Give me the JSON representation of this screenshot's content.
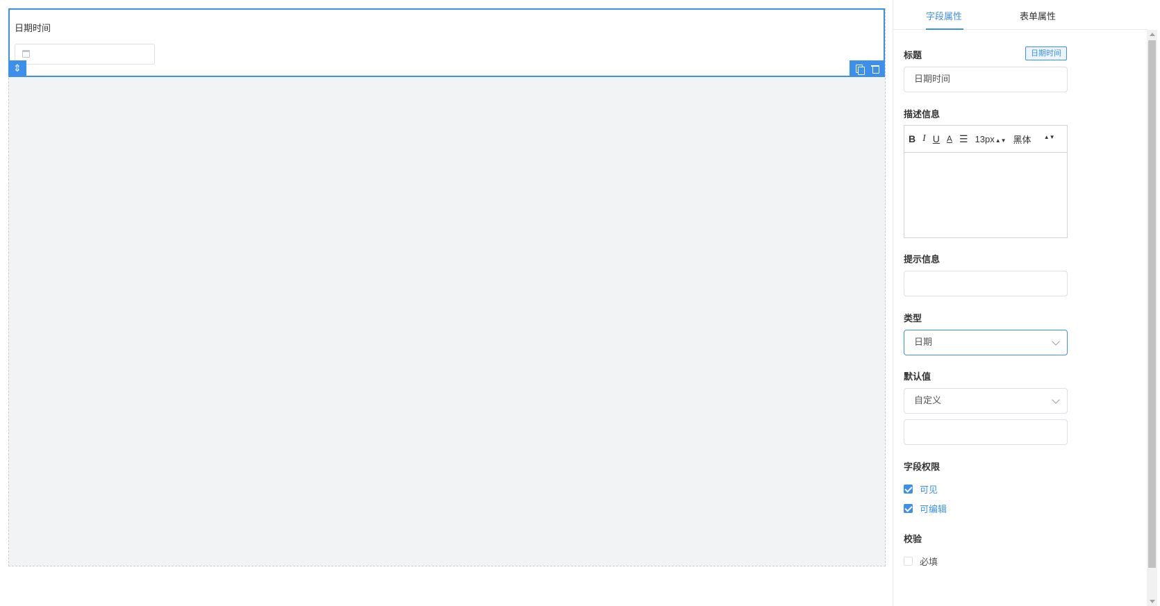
{
  "canvas": {
    "field": {
      "label": "日期时间",
      "drag_icon": "move-vertical-icon",
      "calendar_icon": "calendar-icon",
      "actions": [
        "copy-icon",
        "trash-icon"
      ]
    }
  },
  "panel": {
    "tabs": [
      {
        "label": "字段属性",
        "active": true
      },
      {
        "label": "表单属性",
        "active": false
      }
    ],
    "title": {
      "label": "标题",
      "tag": "日期时间",
      "value": "日期时间"
    },
    "description": {
      "label": "描述信息",
      "toolbar": {
        "bold": "B",
        "italic": "I",
        "underline": "U",
        "color": "A",
        "align": "☰",
        "font_size": "13px",
        "font_family": "黑体"
      }
    },
    "hint": {
      "label": "提示信息",
      "value": ""
    },
    "type": {
      "label": "类型",
      "value": "日期"
    },
    "default": {
      "label": "默认值",
      "value": "自定义",
      "custom_value": ""
    },
    "permission": {
      "label": "字段权限",
      "options": [
        {
          "label": "可见",
          "checked": true
        },
        {
          "label": "可编辑",
          "checked": true
        }
      ]
    },
    "validation": {
      "label": "校验",
      "options": [
        {
          "label": "必填",
          "checked": false
        }
      ]
    }
  },
  "colors": {
    "accent": "#3c90ec",
    "canvas_bg": "#f2f3f5",
    "border": "#dcdfe6"
  }
}
